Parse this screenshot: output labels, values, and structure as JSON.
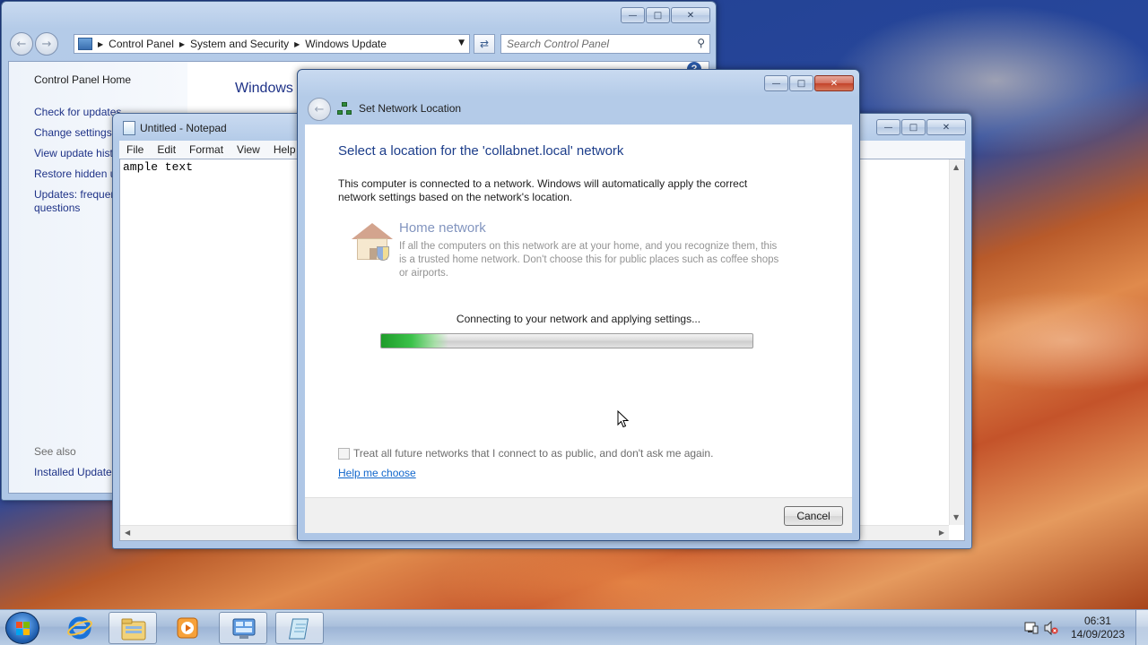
{
  "control_panel": {
    "breadcrumb": [
      "Control Panel",
      "System and Security",
      "Windows Update"
    ],
    "search_placeholder": "Search Control Panel",
    "left_links": {
      "home": "Control Panel Home",
      "check": "Check for updates",
      "change": "Change settings",
      "history": "View update hist",
      "restore": "Restore hidden u",
      "faq_1": "Updates: frequer",
      "faq_2": "questions"
    },
    "see_also": "See also",
    "installed_updates": "Installed Updates",
    "main_title": "Windows U"
  },
  "notepad": {
    "title": "Untitled - Notepad",
    "menu": [
      "File",
      "Edit",
      "Format",
      "View",
      "Help"
    ],
    "content": "ample text"
  },
  "dialog": {
    "title": "Set Network Location",
    "heading": "Select a location for the 'collabnet.local' network",
    "intro": "This computer is connected to a network. Windows will automatically apply the correct network settings based on the network's location.",
    "home_title": "Home network",
    "home_desc": "If all the computers on this network are at your home, and you recognize them, this is a trusted home network.  Don't choose this for public places such as coffee shops or airports.",
    "status": "Connecting to your network and applying settings...",
    "progress_fraction": 0.18,
    "checkbox_label": "Treat all future networks that I connect to as public, and don't ask me again.",
    "checkbox_checked": false,
    "help_link": "Help me choose",
    "cancel": "Cancel"
  },
  "taskbar": {
    "time": "06:31",
    "date": "14/09/2023",
    "pinned": [
      "internet-explorer",
      "windows-explorer",
      "media-player",
      "control-panel",
      "notepad"
    ]
  },
  "colors": {
    "link_blue": "#1e3287",
    "heading_blue": "#1c3d8a",
    "progress_green": "#3bc24a"
  }
}
